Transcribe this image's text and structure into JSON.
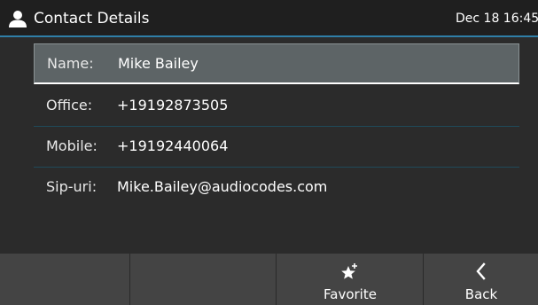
{
  "header": {
    "title": "Contact Details",
    "datetime": "Dec 18 16:45",
    "icon": "person-icon"
  },
  "contact": {
    "fields": [
      {
        "label": "Name:",
        "value": "Mike Bailey",
        "selected": true
      },
      {
        "label": "Office:",
        "value": "+19192873505"
      },
      {
        "label": "Mobile:",
        "value": "+19192440064"
      },
      {
        "label": "Sip-uri:",
        "value": "Mike.Bailey@audiocodes.com"
      }
    ]
  },
  "softkeys": {
    "favorite_label": "Favorite",
    "favorite_icon": "star-plus-icon",
    "back_label": "Back",
    "back_icon": "chevron-left-icon"
  },
  "colors": {
    "header_bg": "#1f1f1f",
    "accent": "#2f7fa8",
    "content_bg": "#2b2b2b",
    "selected_bg": "#5d6466",
    "softkey_bg": "#444444"
  }
}
